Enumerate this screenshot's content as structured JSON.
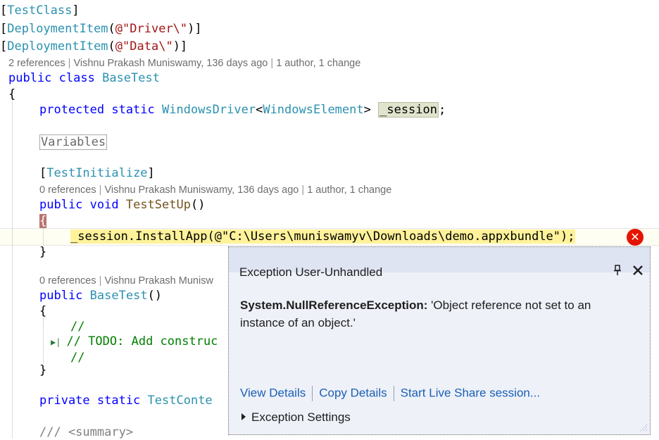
{
  "code": {
    "attr_testclass": "TestClass",
    "attr_deployment": "DeploymentItem",
    "deploy1_str": "@\"Driver\\\"",
    "deploy2_str": "@\"Data\\\"",
    "lens_class": {
      "references": "2 references",
      "author": "Vishnu Prakash Muniswamy, 136 days ago",
      "changes": "1 author, 1 change"
    },
    "class_kw": "public class",
    "class_name": "BaseTest",
    "field_kw": "protected static",
    "field_type": "WindowsDriver",
    "field_generic": "WindowsElement",
    "field_name": "_session",
    "region_label": "Variables",
    "attr_testinit": "TestInitialize",
    "lens_setup": {
      "references": "0 references",
      "author": "Vishnu Prakash Muniswamy, 136 days ago",
      "changes": "1 author, 1 change"
    },
    "setup_kw": "public void",
    "setup_name": "TestSetUp",
    "exec_obj": "_session",
    "exec_method": "InstallApp",
    "exec_str": "@\"C:\\Users\\muniswamyv\\Downloads\\demo.appxbundle\"",
    "lens_ctor": {
      "references": "0 references",
      "author": "Vishnu Prakash Munisw"
    },
    "ctor_kw": "public",
    "ctor_name": "BaseTest",
    "comment_empty": "//",
    "comment_todo_prefix": "// ",
    "comment_todo": "TODO",
    "comment_todo_rest": ": Add construc",
    "private_kw": "private static",
    "private_type": "TestConte",
    "summary": "/// <summary>"
  },
  "exception": {
    "title": "Exception User-Unhandled",
    "type": "System.NullReferenceException:",
    "message": "'Object reference not set to an instance of an object.'",
    "actions": [
      "View Details",
      "Copy Details",
      "Start Live Share session..."
    ],
    "settings": "Exception Settings",
    "icons": [
      "error-icon",
      "pin-icon",
      "close-icon"
    ],
    "error_color": "#e51400"
  }
}
